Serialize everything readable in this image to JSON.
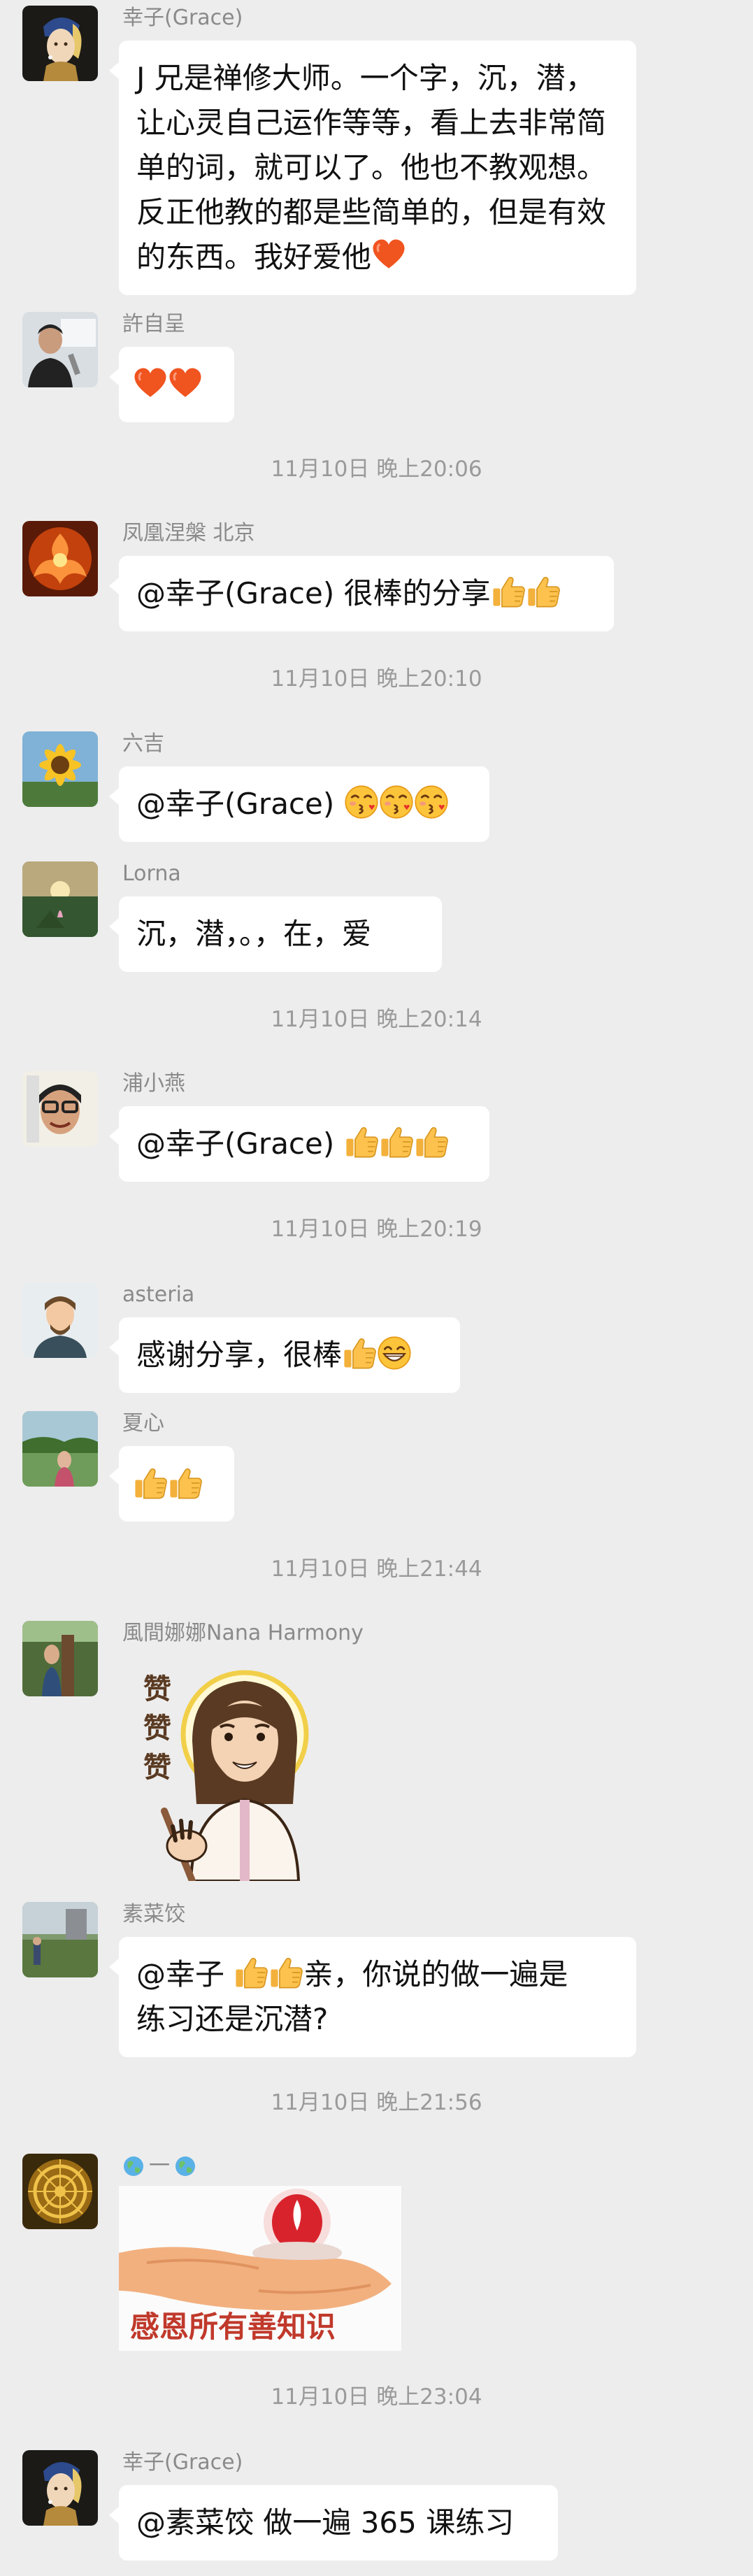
{
  "messages": [
    {
      "sender": "幸子(Grace)",
      "text": "J 兄是禅修大师。一个字，沉，潜，让心灵自己运作等等，看上去非常简单的词，就可以了。他也不教观想。反正他教的都是些简单的，但是有效的东西。我好爱他",
      "trail_emoji": [
        "heart-icon"
      ]
    },
    {
      "sender": "許自呈",
      "text": "",
      "trail_emoji": [
        "heart-icon",
        "heart-icon"
      ]
    },
    {
      "timestamp": "11月10日 晚上20:06"
    },
    {
      "sender": "凤凰涅槃 北京",
      "text": "@幸子(Grace)  很棒的分享",
      "trail_emoji": [
        "thumbs-up-icon",
        "thumbs-up-icon"
      ]
    },
    {
      "timestamp": "11月10日 晚上20:10"
    },
    {
      "sender": "六吉",
      "text": "@幸子(Grace)  ",
      "trail_emoji": [
        "kissing-face-icon",
        "kissing-face-icon",
        "kissing-face-icon"
      ]
    },
    {
      "sender": "Lorna",
      "text": "沉，潜，。，在，爱",
      "trail_emoji": []
    },
    {
      "timestamp": "11月10日 晚上20:14"
    },
    {
      "sender": "浦小燕",
      "text": "@幸子(Grace)  ",
      "trail_emoji": [
        "thumbs-up-icon",
        "thumbs-up-icon",
        "thumbs-up-icon"
      ]
    },
    {
      "timestamp": "11月10日 晚上20:19"
    },
    {
      "sender": "asteria",
      "text": "感谢分享，很棒",
      "trail_emoji": [
        "thumbs-up-icon",
        "grinning-face-icon"
      ]
    },
    {
      "sender": "夏心",
      "text": "",
      "trail_emoji": [
        "thumbs-up-icon",
        "thumbs-up-icon"
      ]
    },
    {
      "timestamp": "11月10日 晚上21:44"
    },
    {
      "sender": "風間娜娜Nana Harmony",
      "sticker": {
        "caption": "赞赞赞"
      }
    },
    {
      "sender": "素菜饺",
      "text_line1": "@幸子  ",
      "text_line1_after": "亲，你说的做一遍是",
      "text_line2": "练习还是沉潜?"
    },
    {
      "timestamp": "11月10日 晚上21:56"
    },
    {
      "sender": "一",
      "image": {
        "caption": "感恩所有善知识"
      }
    },
    {
      "timestamp": "11月10日 晚上23:04"
    },
    {
      "sender": "幸子(Grace)",
      "text": "@素菜饺  做一遍 365 课练习",
      "trail_emoji": []
    }
  ],
  "colors": {
    "background": "#ededed",
    "bubble": "#ffffff",
    "sender_text": "#8a8a8a",
    "timestamp_text": "#9a9a9a",
    "sticker_caption": "#c0392b"
  }
}
